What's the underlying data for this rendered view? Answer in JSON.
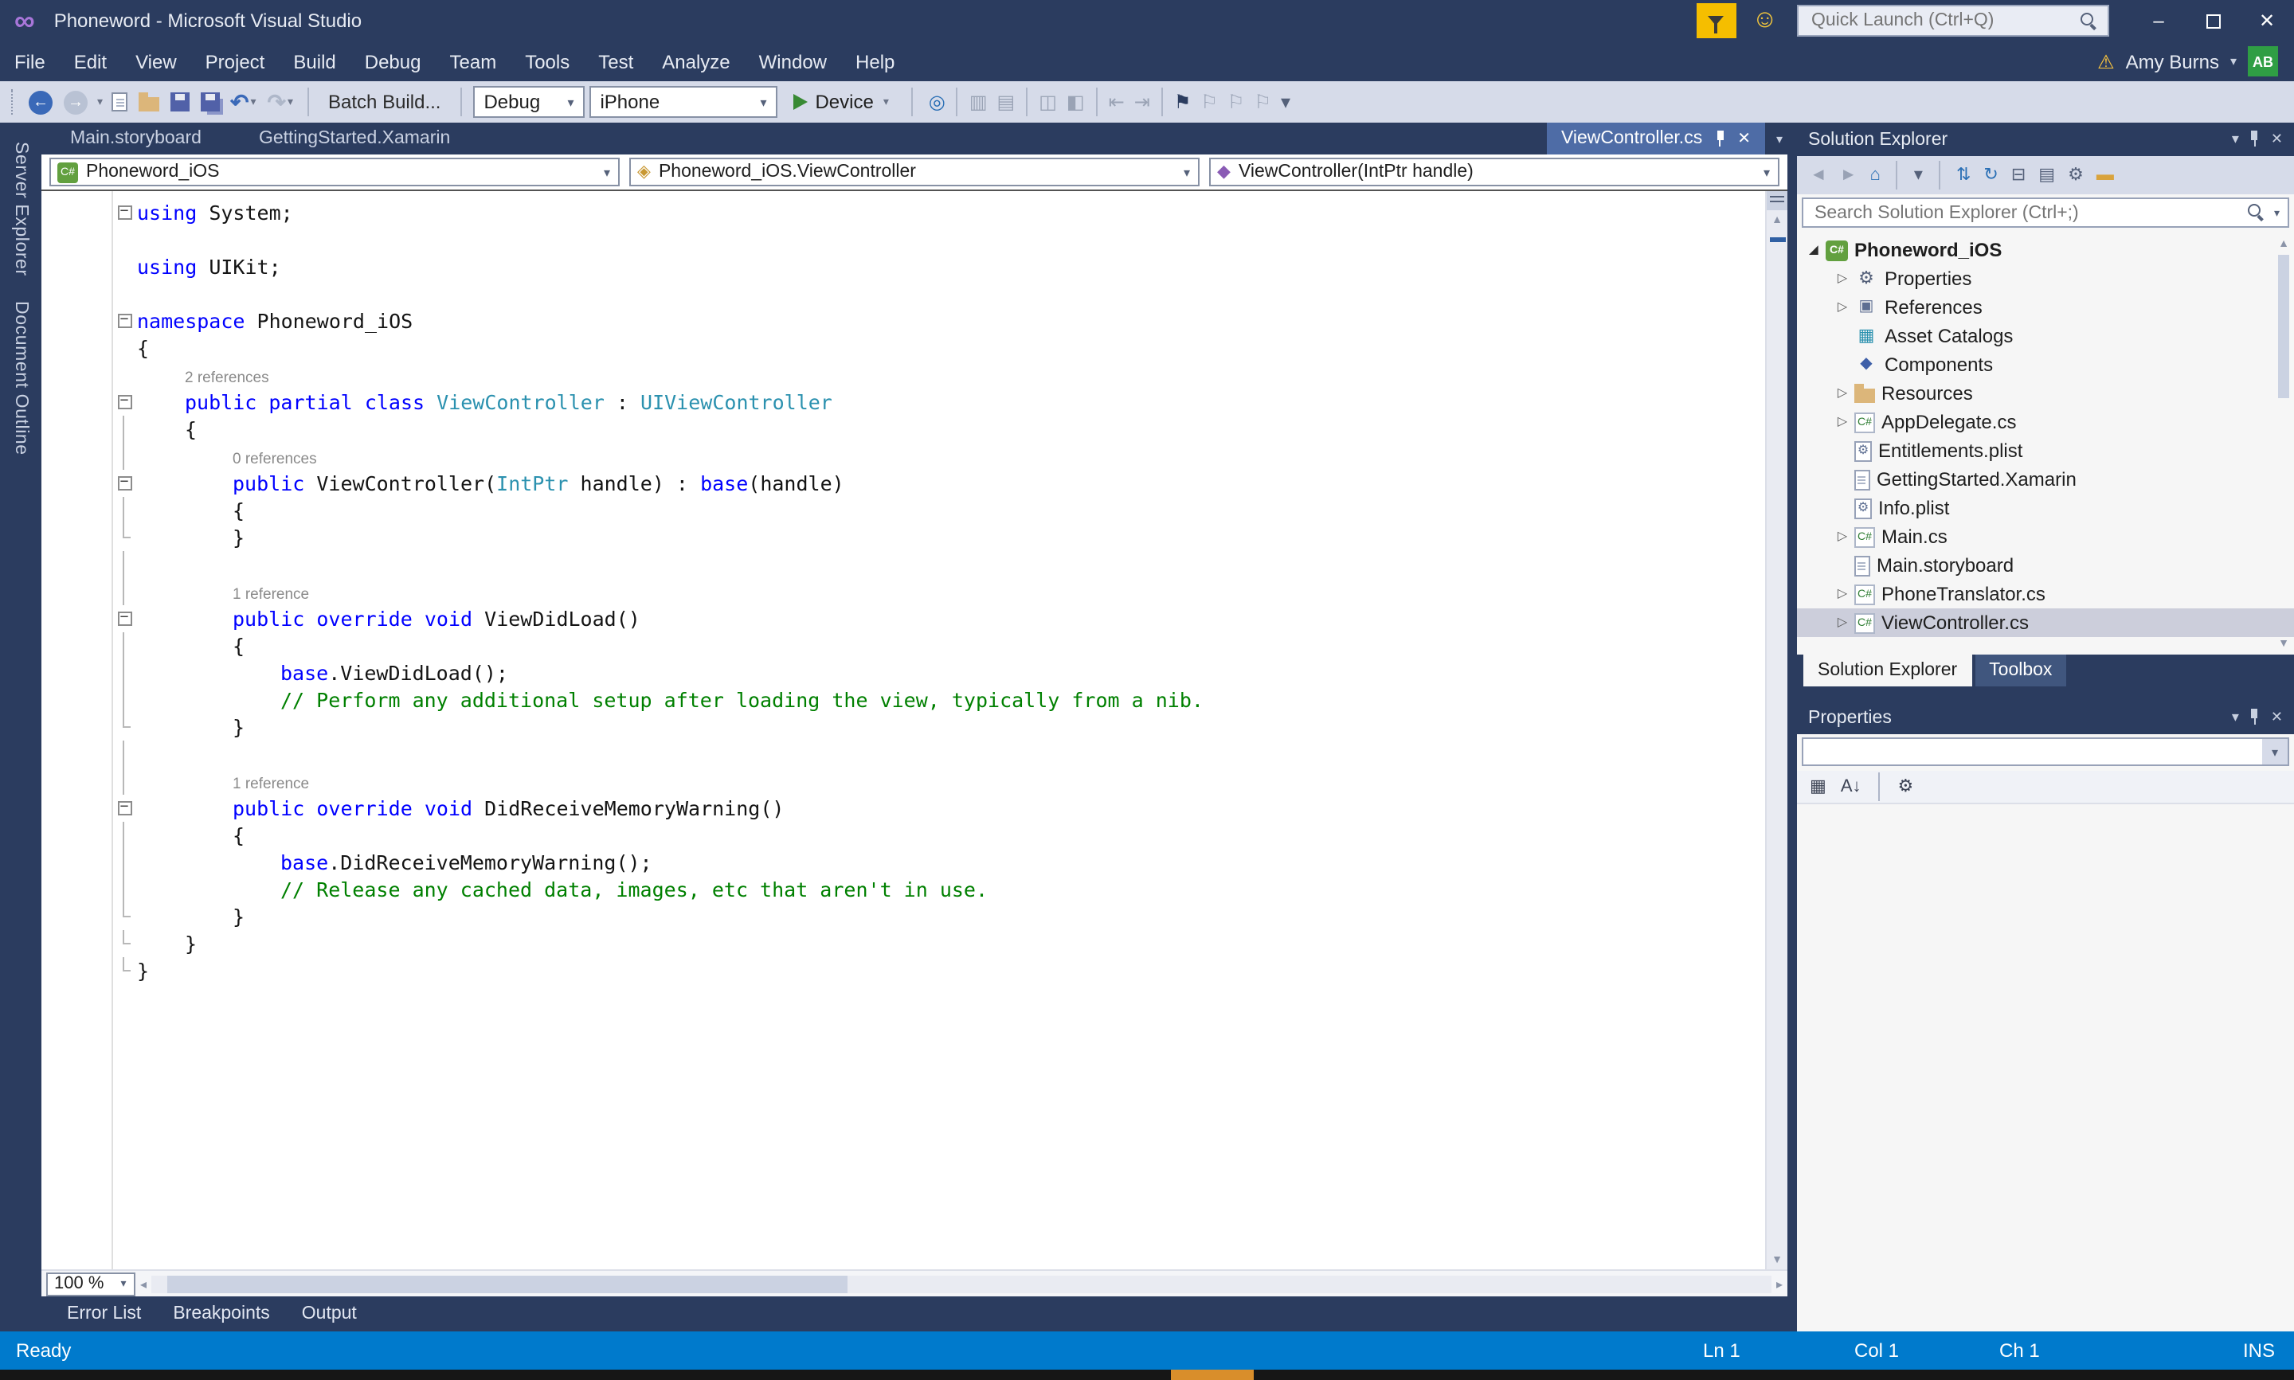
{
  "glyphs": {
    "infinity_logo": "∞",
    "smiley": "☺",
    "warning": "⚠",
    "minimize": "–",
    "close": "✕",
    "menu_caret": "▾",
    "undo": "↶",
    "redo": "↷",
    "back_arrow": "←",
    "fwd_arrow": "→",
    "up_arrow": "▲",
    "down_arrow": "▼",
    "left_arrow": "◂",
    "right_arrow": "▸",
    "fold_minus": "−",
    "expanded_arrow": "◢",
    "collapsed_arrow": "▷"
  },
  "title_bar": {
    "app_title": "Phoneword - Microsoft Visual Studio",
    "quick_launch_placeholder": "Quick Launch (Ctrl+Q)"
  },
  "menu_bar": {
    "items": [
      "File",
      "Edit",
      "View",
      "Project",
      "Build",
      "Debug",
      "Team",
      "Tools",
      "Test",
      "Analyze",
      "Window",
      "Help"
    ],
    "user_name": "Amy Burns",
    "avatar_initials": "AB"
  },
  "toolbar": {
    "batch_build_label": "Batch Build...",
    "config_combo": "Debug",
    "platform_combo": "iPhone",
    "run_button_label": "Device",
    "right_icons": [
      {
        "name": "find-in-files-icon",
        "glyph": "◎",
        "color": "#2A6FB5"
      },
      {
        "sep": true
      },
      {
        "name": "show-output-window-icon",
        "glyph": "▥",
        "color": "#9AA3B5"
      },
      {
        "name": "show-error-list-icon",
        "glyph": "▤",
        "color": "#9AA3B5"
      },
      {
        "sep": true
      },
      {
        "name": "comment-out-icon",
        "glyph": "◫",
        "color": "#9AA3B5"
      },
      {
        "name": "uncomment-icon",
        "glyph": "◧",
        "color": "#9AA3B5"
      },
      {
        "sep": true
      },
      {
        "name": "decrease-indent-icon",
        "glyph": "⇤",
        "color": "#9AA3B5"
      },
      {
        "name": "increase-indent-icon",
        "glyph": "⇥",
        "color": "#9AA3B5"
      },
      {
        "sep": true
      },
      {
        "name": "toggle-bookmark-icon",
        "glyph": "⚑",
        "color": "#2B3C5F"
      },
      {
        "name": "previous-bookmark-icon",
        "glyph": "⚐",
        "color": "#9AA3B5"
      },
      {
        "name": "next-bookmark-icon",
        "glyph": "⚐",
        "color": "#9AA3B5"
      },
      {
        "name": "clear-bookmarks-icon",
        "glyph": "⚐",
        "color": "#9AA3B5"
      },
      {
        "name": "toolbar-options-icon",
        "glyph": "▾",
        "color": "#55617A"
      }
    ]
  },
  "side_strip": {
    "tabs": [
      "Server Explorer",
      "Document Outline"
    ]
  },
  "doc_tabs": {
    "inactive": [
      "Main.storyboard",
      "GettingStarted.Xamarin"
    ],
    "active": "ViewController.cs"
  },
  "nav_bar": {
    "project": "Phoneword_iOS",
    "type": "Phoneword_iOS.ViewController",
    "member": "ViewController(IntPtr handle)"
  },
  "editor": {
    "zoom": "100 %",
    "lines": [
      {
        "fold": "box",
        "seg": [
          [
            "k",
            "using"
          ],
          [
            "p",
            " System;"
          ]
        ]
      },
      {
        "seg": []
      },
      {
        "seg": [
          [
            "k",
            "using"
          ],
          [
            "p",
            " UIKit;"
          ]
        ]
      },
      {
        "seg": []
      },
      {
        "fold": "box",
        "seg": [
          [
            "k",
            "namespace"
          ],
          [
            "p",
            " Phoneword_iOS"
          ]
        ]
      },
      {
        "seg": [
          [
            "p",
            "{"
          ]
        ]
      },
      {
        "lens": true,
        "ind": 1,
        "seg": [
          [
            "cl",
            "2 references"
          ]
        ]
      },
      {
        "fold": "box",
        "ind": 1,
        "seg": [
          [
            "k",
            "public"
          ],
          [
            "p",
            " "
          ],
          [
            "k",
            "partial"
          ],
          [
            "p",
            " "
          ],
          [
            "k",
            "class"
          ],
          [
            "p",
            " "
          ],
          [
            "t",
            "ViewController"
          ],
          [
            "p",
            " : "
          ],
          [
            "t",
            "UIViewController"
          ]
        ]
      },
      {
        "ind": 1,
        "fold": "line",
        "seg": [
          [
            "p",
            "{"
          ]
        ]
      },
      {
        "lens": true,
        "ind": 2,
        "fold": "line",
        "seg": [
          [
            "cl",
            "0 references"
          ]
        ]
      },
      {
        "fold": "box",
        "ind": 2,
        "seg": [
          [
            "k",
            "public"
          ],
          [
            "p",
            " ViewController("
          ],
          [
            "t",
            "IntPtr"
          ],
          [
            "p",
            " handle) : "
          ],
          [
            "k",
            "base"
          ],
          [
            "p",
            "(handle)"
          ]
        ]
      },
      {
        "ind": 2,
        "fold": "line",
        "seg": [
          [
            "p",
            "{"
          ]
        ]
      },
      {
        "ind": 2,
        "fold": "end",
        "seg": [
          [
            "p",
            "}"
          ]
        ]
      },
      {
        "fold": "line",
        "seg": []
      },
      {
        "lens": true,
        "ind": 2,
        "fold": "line",
        "seg": [
          [
            "cl",
            "1 reference"
          ]
        ]
      },
      {
        "fold": "box",
        "ind": 2,
        "seg": [
          [
            "k",
            "public"
          ],
          [
            "p",
            " "
          ],
          [
            "k",
            "override"
          ],
          [
            "p",
            " "
          ],
          [
            "k",
            "void"
          ],
          [
            "p",
            " ViewDidLoad()"
          ]
        ]
      },
      {
        "ind": 2,
        "fold": "line",
        "seg": [
          [
            "p",
            "{"
          ]
        ]
      },
      {
        "ind": 3,
        "fold": "line",
        "seg": [
          [
            "k",
            "base"
          ],
          [
            "p",
            ".ViewDidLoad();"
          ]
        ]
      },
      {
        "ind": 3,
        "fold": "line",
        "seg": [
          [
            "c",
            "// Perform any additional setup after loading the view, typically from a nib."
          ]
        ]
      },
      {
        "ind": 2,
        "fold": "end",
        "seg": [
          [
            "p",
            "}"
          ]
        ]
      },
      {
        "fold": "line",
        "seg": []
      },
      {
        "lens": true,
        "ind": 2,
        "fold": "line",
        "seg": [
          [
            "cl",
            "1 reference"
          ]
        ]
      },
      {
        "fold": "box",
        "ind": 2,
        "seg": [
          [
            "k",
            "public"
          ],
          [
            "p",
            " "
          ],
          [
            "k",
            "override"
          ],
          [
            "p",
            " "
          ],
          [
            "k",
            "void"
          ],
          [
            "p",
            " DidReceiveMemoryWarning()"
          ]
        ]
      },
      {
        "ind": 2,
        "fold": "line",
        "seg": [
          [
            "p",
            "{"
          ]
        ]
      },
      {
        "ind": 3,
        "fold": "line",
        "seg": [
          [
            "k",
            "base"
          ],
          [
            "p",
            ".DidReceiveMemoryWarning();"
          ]
        ]
      },
      {
        "ind": 3,
        "fold": "line",
        "seg": [
          [
            "c",
            "// Release any cached data, images, etc that aren't in use."
          ]
        ]
      },
      {
        "ind": 2,
        "fold": "end",
        "seg": [
          [
            "p",
            "}"
          ]
        ]
      },
      {
        "ind": 1,
        "fold": "end",
        "seg": [
          [
            "p",
            "}"
          ]
        ]
      },
      {
        "fold": "end",
        "seg": [
          [
            "p",
            "}"
          ]
        ]
      }
    ]
  },
  "bottom_panel_tabs": [
    "Error List",
    "Breakpoints",
    "Output"
  ],
  "status_bar": {
    "message": "Ready",
    "line": "Ln 1",
    "column": "Col 1",
    "character": "Ch 1",
    "mode": "INS"
  },
  "solution_explorer": {
    "title": "Solution Explorer",
    "search_placeholder": "Search Solution Explorer (Ctrl+;)",
    "toolbar_icons": [
      {
        "name": "back-icon",
        "glyph": "◄",
        "color": "#99A2B5"
      },
      {
        "name": "forward-icon",
        "glyph": "►",
        "color": "#99A2B5"
      },
      {
        "name": "home-icon",
        "glyph": "⌂",
        "color": "#2A6FB5"
      },
      {
        "sep": true
      },
      {
        "name": "filter-dropdown-icon",
        "glyph": "▾",
        "color": "#55617A"
      },
      {
        "sep": true
      },
      {
        "name": "sync-with-active-document-icon",
        "glyph": "⇅",
        "color": "#2A6FB5"
      },
      {
        "name": "refresh-icon",
        "glyph": "↻",
        "color": "#2A6FB5"
      },
      {
        "name": "collapse-all-icon",
        "glyph": "⊟",
        "color": "#55617A"
      },
      {
        "name": "show-all-files-icon",
        "glyph": "▤",
        "color": "#55617A"
      },
      {
        "name": "properties-icon",
        "glyph": "⚙",
        "color": "#55617A"
      },
      {
        "name": "preview-selected-items-icon",
        "glyph": "▬",
        "color": "#D9A33C"
      }
    ],
    "tree": [
      {
        "label": "Phoneword_iOS",
        "icon": "csproj",
        "arrow": "expanded",
        "bold": true,
        "level": 0
      },
      {
        "label": "Properties",
        "icon": "wrench",
        "arrow": "collapsed",
        "level": 1
      },
      {
        "label": "References",
        "icon": "references",
        "arrow": "collapsed",
        "level": 1
      },
      {
        "label": "Asset Catalogs",
        "icon": "assets",
        "arrow": "none",
        "level": 1
      },
      {
        "label": "Components",
        "icon": "components",
        "arrow": "none",
        "level": 1
      },
      {
        "label": "Resources",
        "icon": "folder",
        "arrow": "collapsed",
        "level": 1
      },
      {
        "label": "AppDelegate.cs",
        "icon": "cs",
        "arrow": "collapsed",
        "level": 1
      },
      {
        "label": "Entitlements.plist",
        "icon": "plist",
        "arrow": "none",
        "level": 1
      },
      {
        "label": "GettingStarted.Xamarin",
        "icon": "file",
        "arrow": "none",
        "level": 1
      },
      {
        "label": "Info.plist",
        "icon": "plist",
        "arrow": "none",
        "level": 1
      },
      {
        "label": "Main.cs",
        "icon": "cs",
        "arrow": "collapsed",
        "level": 1
      },
      {
        "label": "Main.storyboard",
        "icon": "file",
        "arrow": "none",
        "level": 1
      },
      {
        "label": "PhoneTranslator.cs",
        "icon": "cs",
        "arrow": "collapsed",
        "level": 1
      },
      {
        "label": "ViewController.cs",
        "icon": "cs",
        "arrow": "collapsed",
        "level": 1,
        "selected": true
      }
    ],
    "tabs": [
      {
        "label": "Solution Explorer",
        "active": true
      },
      {
        "label": "Toolbox",
        "active": false
      }
    ]
  },
  "properties_panel": {
    "title": "Properties",
    "toolbar_icons": [
      {
        "name": "categorized-icon",
        "glyph": "▦",
        "color": "#3C4354"
      },
      {
        "name": "alphabetical-icon",
        "glyph": "A↓",
        "color": "#3C4354"
      },
      {
        "sep": true
      },
      {
        "name": "property-pages-icon",
        "glyph": "⚙",
        "color": "#3C4354"
      }
    ]
  }
}
